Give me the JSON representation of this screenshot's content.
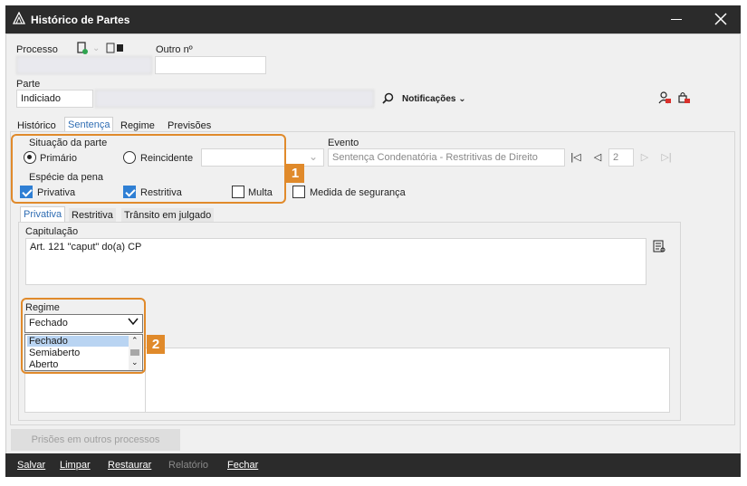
{
  "window": {
    "title": "Histórico de Partes"
  },
  "processo": {
    "label": "Processo",
    "outro_label": "Outro nº",
    "number_value": "",
    "outro_value": ""
  },
  "parte": {
    "label": "Parte",
    "role_value": "Indiciado",
    "name_value": "",
    "notificacoes_label": "Notificações"
  },
  "tabs_top": [
    "Histórico",
    "Sentença",
    "Regime",
    "Previsões"
  ],
  "situacao": {
    "legend": "Situação da parte",
    "primario": "Primário",
    "reincidente": "Reincidente",
    "primario_selected": true
  },
  "evento": {
    "label": "Evento",
    "value": "Sentença Condenatória - Restritivas de Direito",
    "counter": "2"
  },
  "especie": {
    "legend": "Espécie da pena",
    "privativa": "Privativa",
    "restritiva": "Restritiva",
    "multa": "Multa",
    "medida": "Medida de segurança"
  },
  "badges": {
    "one": "1",
    "two": "2"
  },
  "tabs_sub": [
    "Privativa",
    "Restritiva",
    "Trânsito em julgado"
  ],
  "capitulacao": {
    "label": "Capitulação",
    "value": "Art. 121 \"caput\" do(a) CP"
  },
  "regime": {
    "label": "Regime",
    "selected": "Fechado",
    "options": [
      "Fechado",
      "Semiaberto",
      "Aberto"
    ]
  },
  "prisoes_button": "Prisões em outros processos",
  "bottom_menu": {
    "salvar": "Salvar",
    "limpar": "Limpar",
    "restaurar": "Restaurar",
    "relatorio": "Relatório",
    "fechar": "Fechar"
  },
  "colors": {
    "accent": "#2f7fd4",
    "highlight": "#e08a2b",
    "titlebar": "#2b2b2b"
  }
}
